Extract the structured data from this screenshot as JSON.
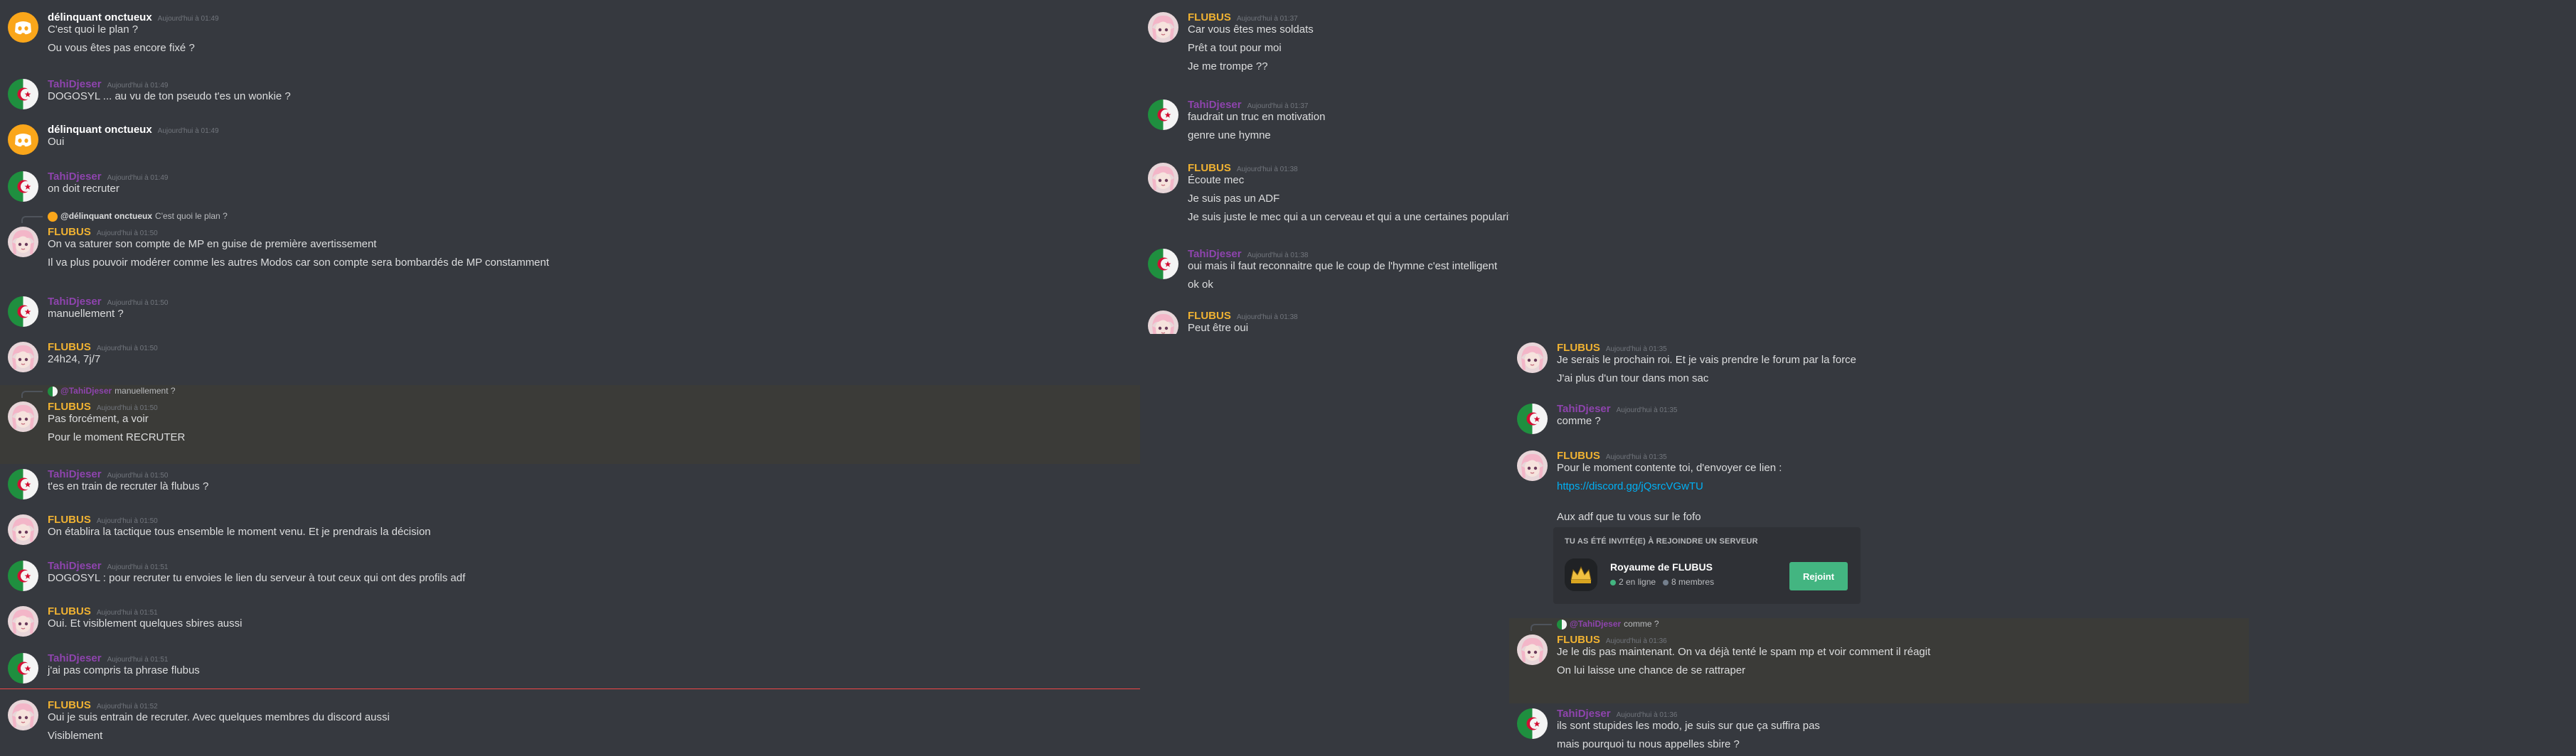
{
  "colors": {
    "background": "#36393f",
    "flubus": "#f0b232",
    "tahi": "#8e44ad",
    "delinquant": "#ffffff",
    "link": "#00b0f4",
    "new_messages_divider": "#f04747",
    "join_button": "#43b581"
  },
  "icons": {
    "discord_default_avatar": "discord-logo-icon",
    "flubus_avatar": "anime-girl-avatar",
    "tahi_avatar": "algeria-flag-avatar",
    "server_icon": "crown-icon"
  },
  "left": {
    "messages": [
      {
        "author": "délinquant onctueux",
        "time": "Aujourd'hui à 01:49",
        "lines": [
          "C'est quoi le plan ?",
          "Ou vous êtes pas encore fixé ?"
        ]
      },
      {
        "author": "TahiDjeser",
        "time": "Aujourd'hui à 01:49",
        "lines": [
          "DOGOSYL ... au vu de ton pseudo t'es un wonkie ?"
        ]
      },
      {
        "author": "délinquant onctueux",
        "time": "Aujourd'hui à 01:49",
        "lines": [
          "Oui"
        ]
      },
      {
        "author": "TahiDjeser",
        "time": "Aujourd'hui à 01:49",
        "lines": [
          "on doit recruter"
        ]
      },
      {
        "reply": {
          "author": "@délinquant onctueux",
          "text": "C'est quoi le plan ?"
        },
        "author": "FLUBUS",
        "time": "Aujourd'hui à 01:50",
        "lines": [
          "On va saturer son compte de MP en guise de première avertissement",
          "Il va plus pouvoir modérer comme les autres Modos car son compte sera bombardés de MP constamment"
        ]
      },
      {
        "author": "TahiDjeser",
        "time": "Aujourd'hui à 01:50",
        "lines": [
          "manuellement ?"
        ]
      },
      {
        "author": "FLUBUS",
        "time": "Aujourd'hui à 01:50",
        "lines": [
          "24h24, 7j/7"
        ]
      },
      {
        "reply": {
          "author": "@TahiDjeser",
          "text": "manuellement ?"
        },
        "author": "FLUBUS",
        "time": "Aujourd'hui à 01:50",
        "lines": [
          "Pas forcément, a voir",
          "Pour le moment RECRUTER"
        ]
      },
      {
        "author": "TahiDjeser",
        "time": "Aujourd'hui à 01:50",
        "lines": [
          "t'es en train de recruter là flubus ?"
        ]
      },
      {
        "author": "FLUBUS",
        "time": "Aujourd'hui à 01:50",
        "lines": [
          "On établira la tactique tous ensemble le moment venu. Et je prendrais la décision"
        ]
      },
      {
        "author": "TahiDjeser",
        "time": "Aujourd'hui à 01:51",
        "lines": [
          "DOGOSYL : pour recruter tu envoies le lien du serveur à tout ceux qui ont des profils adf"
        ]
      },
      {
        "author": "FLUBUS",
        "time": "Aujourd'hui à 01:51",
        "lines": [
          "Oui. Et visiblement quelques sbires aussi"
        ]
      },
      {
        "author": "TahiDjeser",
        "time": "Aujourd'hui à 01:51",
        "lines": [
          "j'ai pas compris ta phrase flubus"
        ]
      },
      {
        "author": "FLUBUS",
        "time": "Aujourd'hui à 01:52",
        "lines": [
          "Oui je suis entrain de recruter. Avec quelques membres du discord aussi",
          "Visiblement"
        ]
      }
    ]
  },
  "middle": {
    "messages": [
      {
        "author": "FLUBUS",
        "time": "Aujourd'hui à 01:37",
        "lines": [
          "Car vous êtes mes soldats",
          "Prêt a tout pour moi",
          "Je me trompe ??"
        ]
      },
      {
        "author": "TahiDjeser",
        "time": "Aujourd'hui à 01:37",
        "lines": [
          "faudrait un truc en motivation",
          "genre une hymne"
        ]
      },
      {
        "author": "FLUBUS",
        "time": "Aujourd'hui à 01:38",
        "lines": [
          "Écoute mec",
          "Je suis pas un ADF",
          "Je suis juste le mec qui a un cerveau et qui a une certaines popularité pour organiser la Rébellion"
        ]
      },
      {
        "author": "TahiDjeser",
        "time": "Aujourd'hui à 01:38",
        "lines": [
          "oui mais il faut reconnaitre que le coup de l'hymne c'est intelligent",
          "ok ok"
        ]
      },
      {
        "author": "FLUBUS",
        "time": "Aujourd'hui à 01:38",
        "lines": [
          "Peut être oui"
        ]
      }
    ]
  },
  "right": {
    "messages": [
      {
        "author": "FLUBUS",
        "time": "Aujourd'hui à 01:35",
        "lines": [
          "Je serais le prochain roi. Et je vais prendre le forum par la force",
          "J'ai plus d'un tour dans mon sac"
        ]
      },
      {
        "author": "TahiDjeser",
        "time": "Aujourd'hui à 01:35",
        "lines": [
          "comme ?"
        ]
      },
      {
        "author": "FLUBUS",
        "time": "Aujourd'hui à 01:35",
        "lines": [
          "Pour le moment contente toi, d'envoyer ce lien :"
        ],
        "link": "https://discord.gg/jQsrcVGwTU",
        "after": "Aux adf que tu vous sur le fofo"
      },
      {
        "reply": {
          "author": "@TahiDjeser",
          "text": "comme ?"
        },
        "author": "FLUBUS",
        "time": "Aujourd'hui à 01:36",
        "lines": [
          "Je le dis pas maintenant. On va déjà tenté le spam mp et voir comment il réagit",
          "On lui laisse une chance de se rattraper"
        ]
      },
      {
        "author": "TahiDjeser",
        "time": "Aujourd'hui à 01:36",
        "lines": [
          "ils sont stupides les modo, je suis sur que ça suffira pas",
          "mais pourquoi tu nous appelles sbire ?"
        ]
      }
    ],
    "invite": {
      "title": "TU AS ÉTÉ INVITÉ(E) À REJOINDRE UN SERVEUR",
      "server": "Royaume de FLUBUS",
      "online": "2 en ligne",
      "members": "8 membres",
      "join": "Rejoint"
    }
  }
}
